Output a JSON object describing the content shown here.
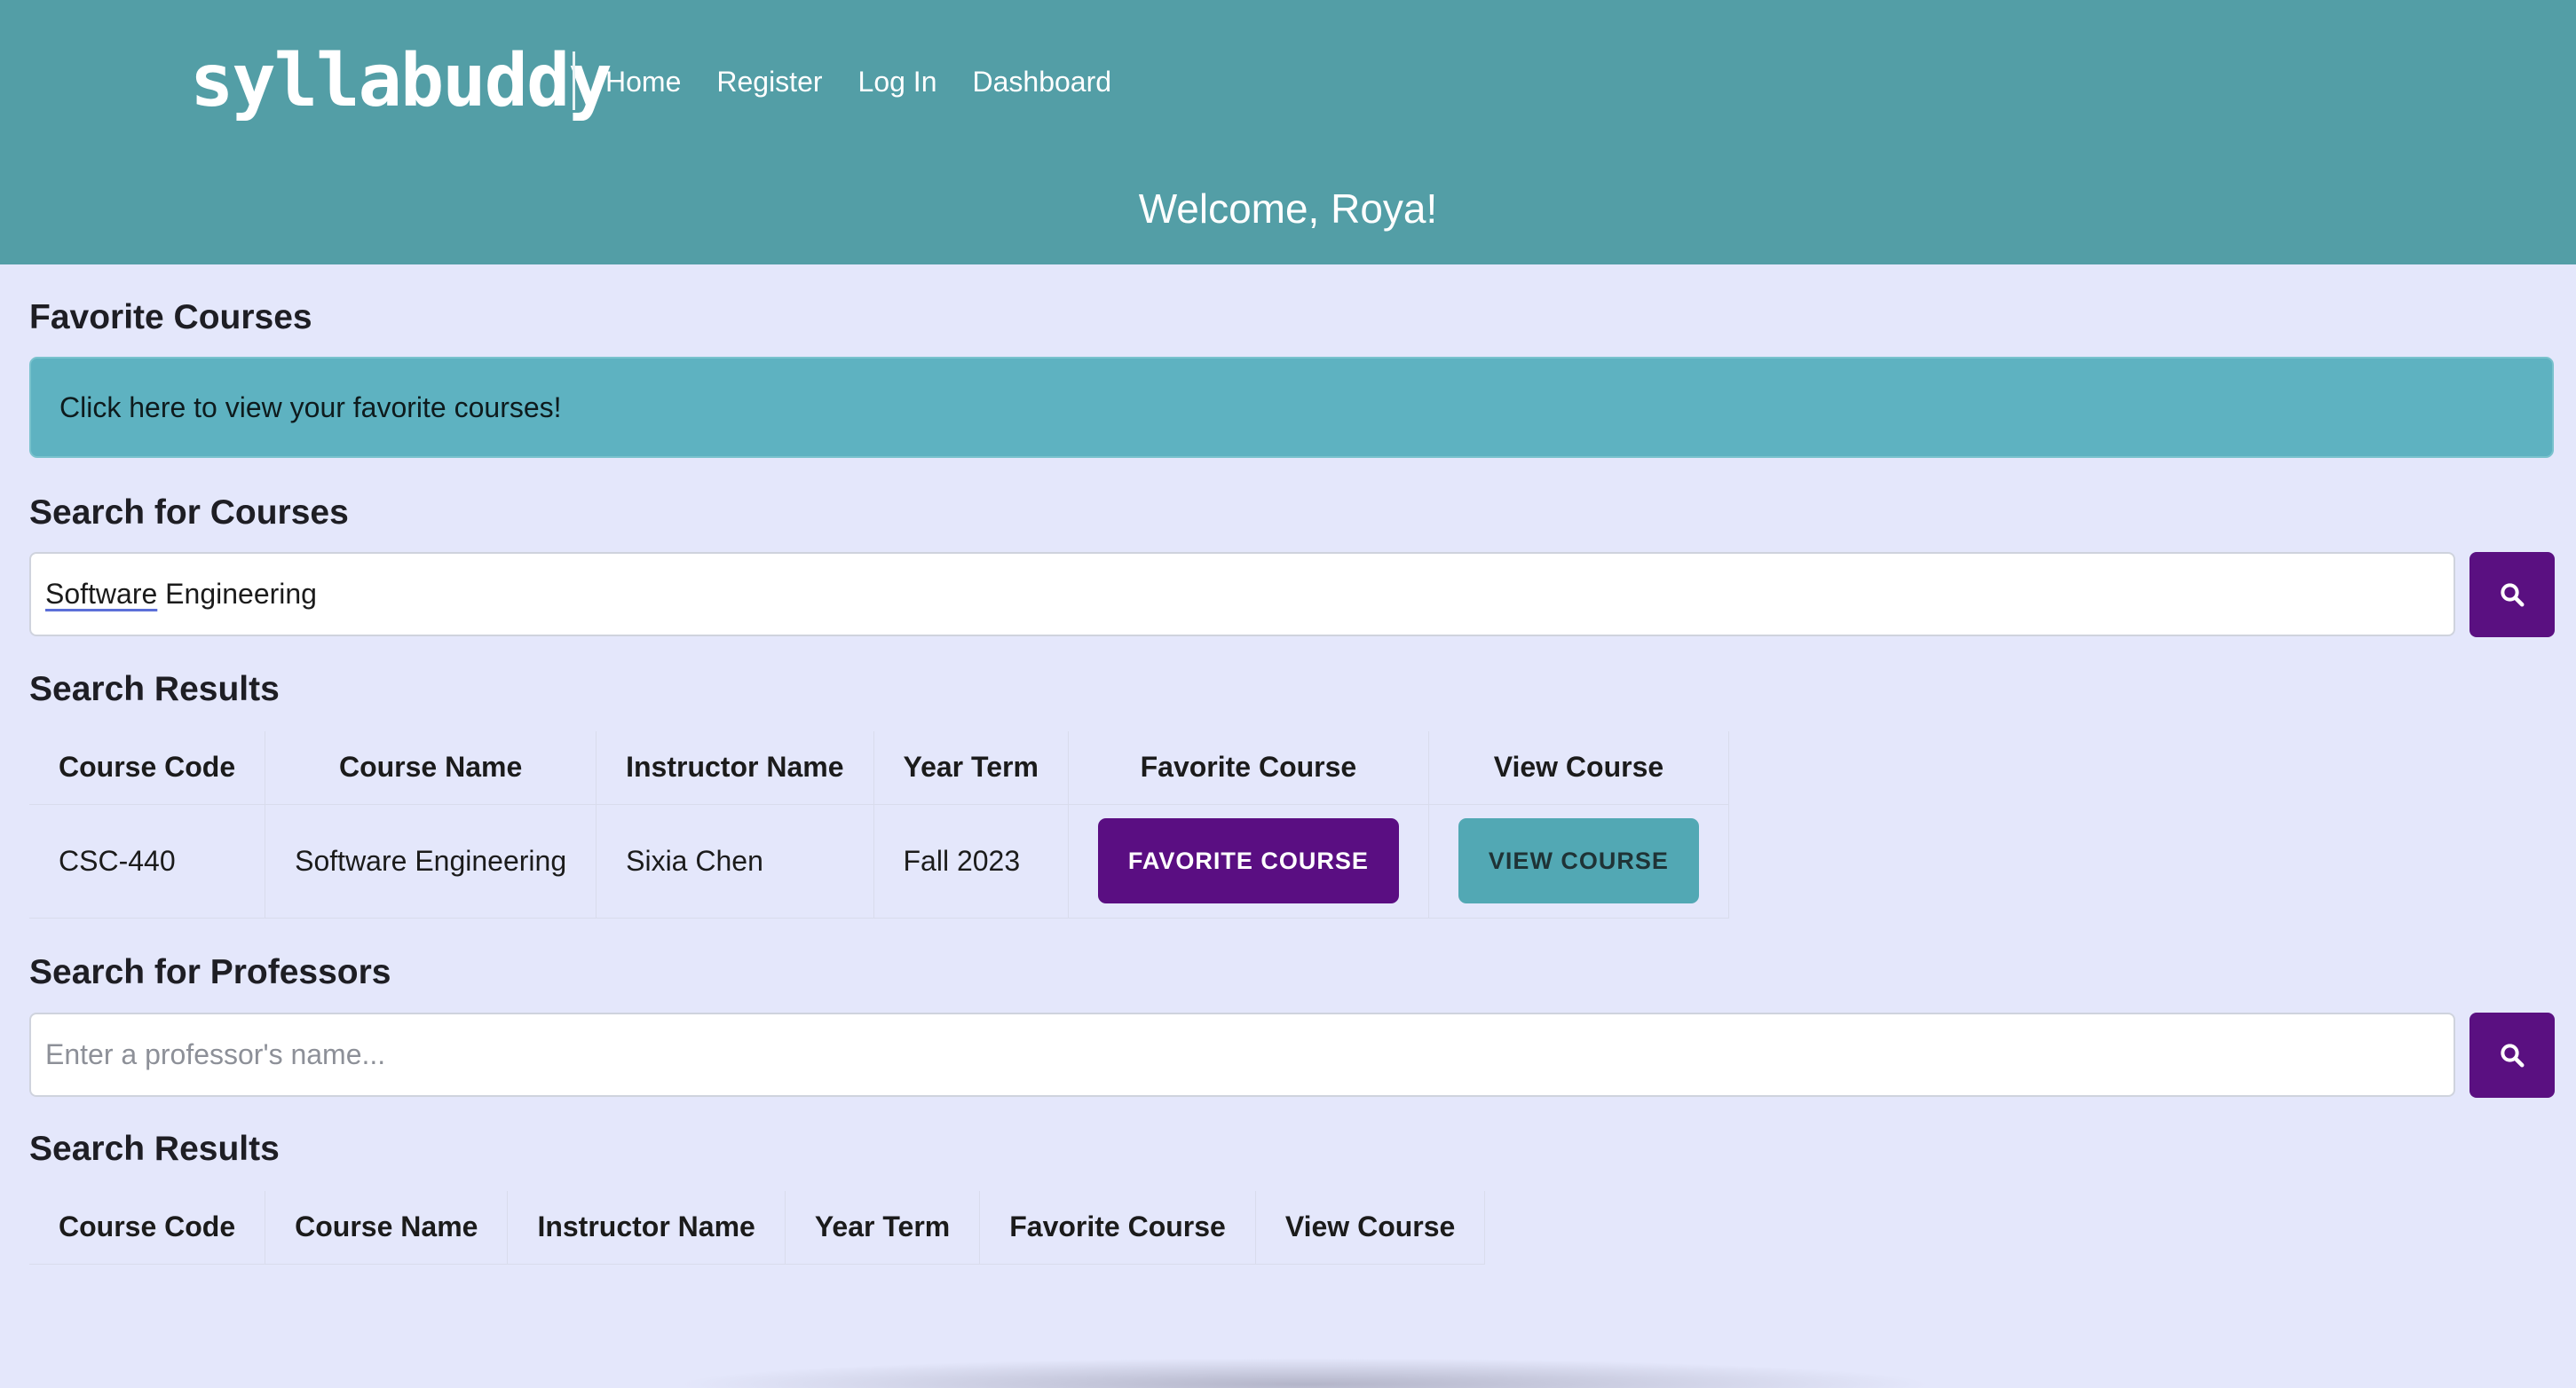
{
  "header": {
    "logo_text": "syllabuddy",
    "nav": [
      "Home",
      "Register",
      "Log In",
      "Dashboard"
    ],
    "welcome": "Welcome, Roya!"
  },
  "favorites": {
    "heading": "Favorite Courses",
    "banner": "Click here to view your favorite courses!"
  },
  "course_search": {
    "heading": "Search for Courses",
    "value_first": "Software",
    "value_rest": " Engineering",
    "search_icon": "search-icon"
  },
  "course_results": {
    "heading": "Search Results",
    "columns": [
      "Course Code",
      "Course Name",
      "Instructor Name",
      "Year Term",
      "Favorite Course",
      "View Course"
    ],
    "rows": [
      {
        "code": "CSC-440",
        "name": "Software Engineering",
        "instructor": "Sixia Chen",
        "term": "Fall 2023",
        "favorite_label": "FAVORITE COURSE",
        "view_label": "VIEW COURSE"
      }
    ]
  },
  "professor_search": {
    "heading": "Search for Professors",
    "placeholder": "Enter a professor's name...",
    "search_icon": "search-icon"
  },
  "professor_results": {
    "heading": "Search Results",
    "columns": [
      "Course Code",
      "Course Name",
      "Instructor Name",
      "Year Term",
      "Favorite Course",
      "View Course"
    ]
  },
  "colors": {
    "header_bg": "#539ea6",
    "page_bg": "#e4e7fb",
    "banner_bg": "#5eb2c1",
    "primary_purple": "#5a0e82",
    "teal_button": "#52a8b4"
  }
}
